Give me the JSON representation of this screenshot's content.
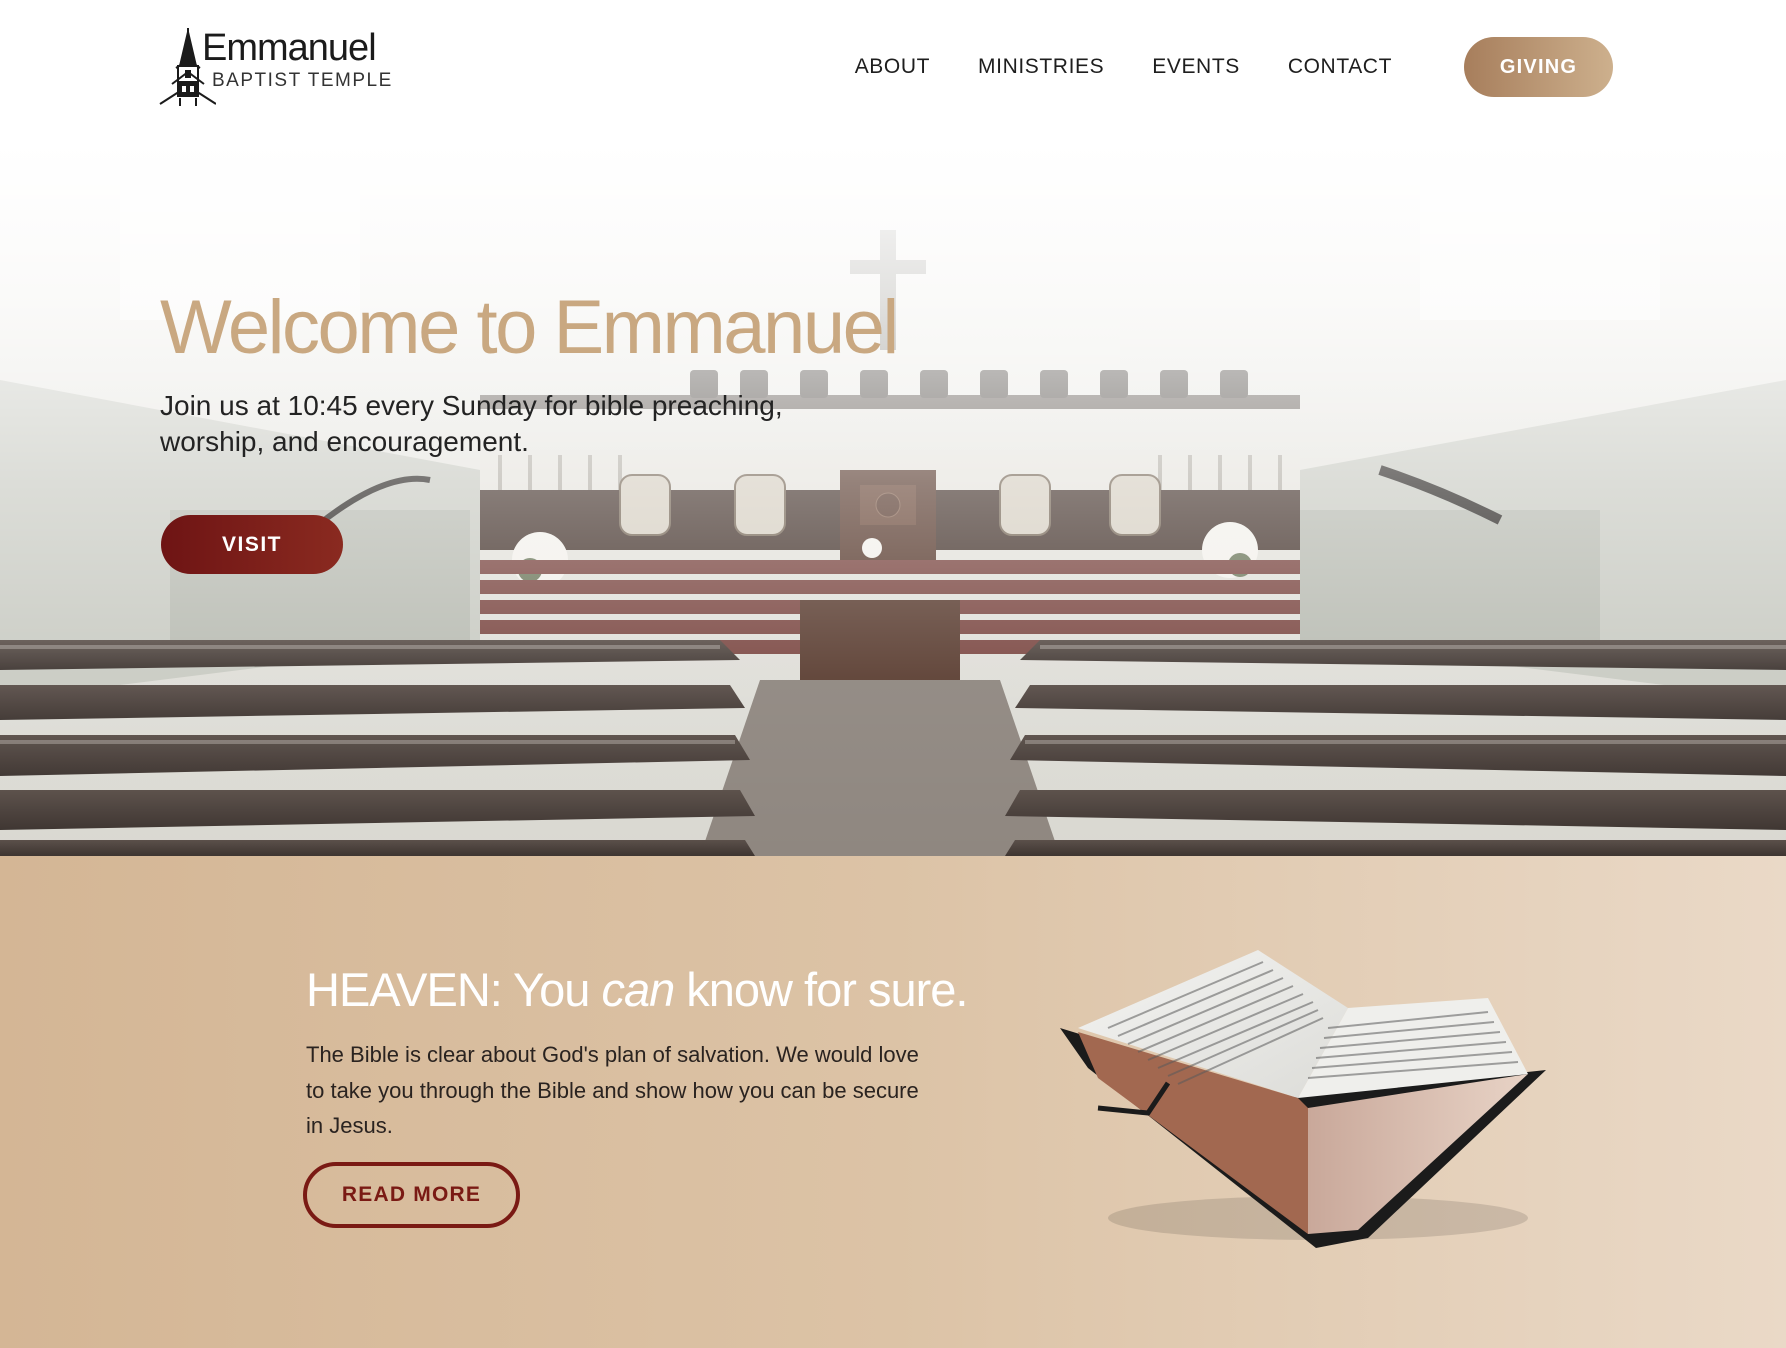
{
  "brand": {
    "title": "Emmanuel",
    "subtitle": "BAPTIST TEMPLE",
    "logo_icon": "church-steeple-icon"
  },
  "nav": {
    "items": [
      "ABOUT",
      "MINISTRIES",
      "EVENTS",
      "CONTACT"
    ],
    "giving_label": "GIVING"
  },
  "hero": {
    "title": "Welcome to Emmanuel",
    "text": "Join us at 10:45 every Sunday for bible preaching, worship, and encouragement.",
    "visit_label": "VISIT",
    "background": "church-sanctuary-photo"
  },
  "heaven": {
    "title_start": "HEAVEN: You ",
    "title_em": "can",
    "title_end": " know for sure.",
    "text": "The Bible is clear about God's plan of salvation. We would love to take you through the Bible and show how you can be secure in Jesus.",
    "read_more_label": "READ MORE",
    "image": "open-bible-image"
  },
  "colors": {
    "accent_gold": "#c9a881",
    "giving_gradient": [
      "#a77e5c",
      "#cdb08d"
    ],
    "visit_red": "#7a1a14",
    "section_tan": "#d4b695"
  }
}
